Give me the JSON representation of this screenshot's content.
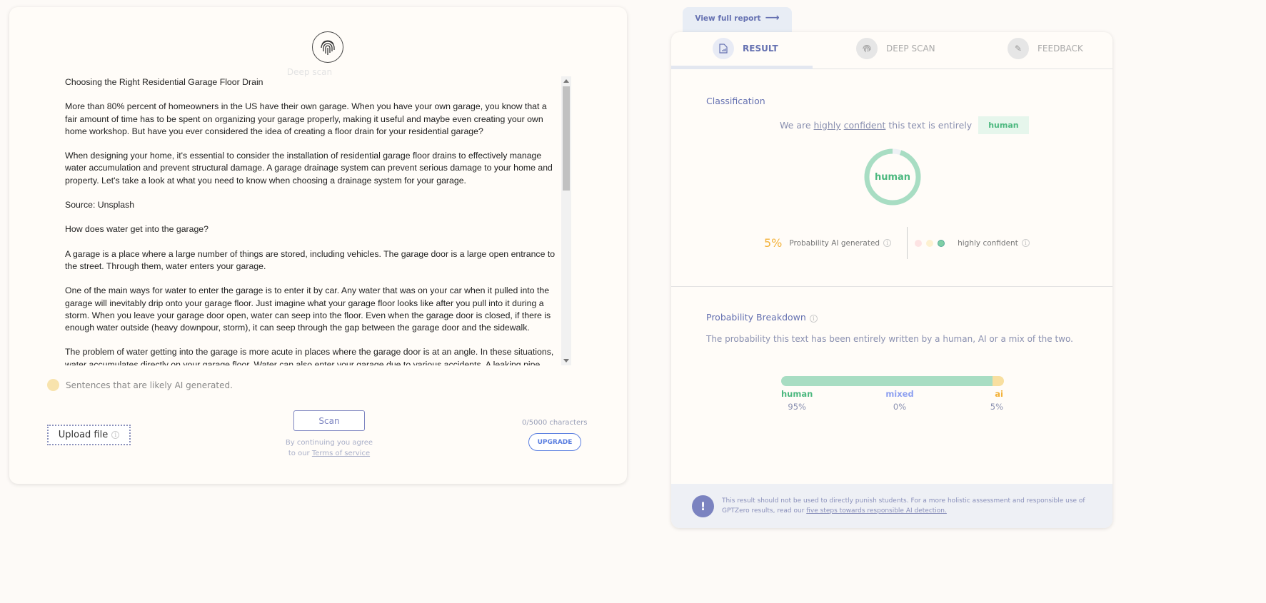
{
  "left": {
    "deep_scan_label": "Deep scan",
    "paragraphs": [
      "Choosing the Right Residential Garage Floor Drain",
      "More than 80% percent of homeowners in the US have their own garage. When you have your own garage, you know that a fair amount of time has to be spent on organizing your garage properly, making it useful and maybe even creating your own home workshop. But have you ever considered the idea of creating a floor drain for your residential garage?",
      "When designing your home, it's essential to consider the installation of residential garage floor drains to effectively manage water accumulation and prevent structural damage. A garage drainage system can prevent serious damage to your home and property. Let's take a look at what you need to know when choosing a drainage system for your garage.",
      "Source: Unsplash",
      "How does water get into the garage?",
      "A garage is a place where a large number of things are stored, including vehicles. The garage door is a large open entrance to the street. Through them, water enters your garage.",
      "One of the main ways for water to enter the garage is to enter it by car. Any water that was on your car when it pulled into the garage will inevitably drip onto your garage floor. Just imagine what your garage floor looks like after you pull into it during a storm. When you leave your garage door open, water can seep into the floor. Even when the garage door is closed, if there is enough water outside (heavy downpour, storm), it can seep through the gap between the garage door and the sidewalk.",
      "The problem of water getting into the garage is more acute in places where the garage door is at an angle. In these situations, water accumulates directly on your garage floor. Water can also enter your garage due to various accidents. A leaking pipe outside or even someone spilling a bucket of water are all potential problems."
    ],
    "legend": "Sentences that are likely AI generated.",
    "upload_label": "Upload file",
    "scan_label": "Scan",
    "agree_line1": "By continuing you agree",
    "agree_line2": "to our ",
    "terms_link": "Terms of service",
    "char_count": "0/5000 characters",
    "upgrade_label": "UPGRADE"
  },
  "right": {
    "view_full_report": "View full report",
    "tabs": [
      {
        "label": "RESULT",
        "icon": "file-chart-icon",
        "active": true
      },
      {
        "label": "DEEP SCAN",
        "icon": "fingerprint-icon"
      },
      {
        "label": "FEEDBACK",
        "icon": "pencil-icon"
      }
    ],
    "classification_title": "Classification",
    "conf_pre": "We are",
    "conf_w1": "highly",
    "conf_w2": "confident",
    "conf_post": "this text is entirely",
    "result_pill": "human",
    "ring_label": "human",
    "ring_human_fraction": 0.95,
    "prob_ai": "5%",
    "prob_ai_label": "Probability AI generated",
    "confidence_label": "highly confident",
    "breakdown_title": "Probability Breakdown",
    "breakdown_desc": "The probability this text has been entirely written by a human, AI or a mix of the two.",
    "breakdown": [
      {
        "label": "human",
        "value": "95%",
        "pct": 95,
        "color": "#a8ddc3",
        "text_color": "#4cb87f"
      },
      {
        "label": "mixed",
        "value": "0%",
        "pct": 0,
        "color": "#a5b4f0",
        "text_color": "#8ea0f0"
      },
      {
        "label": "ai",
        "value": "5%",
        "pct": 5,
        "color": "#f8dfa0",
        "text_color": "#f3b23a"
      }
    ],
    "footer_text": "This result should not be used to directly punish students. For a more holistic assessment and responsible use of GPTZero results, read our ",
    "footer_link": "five steps towards responsible AI detection."
  }
}
